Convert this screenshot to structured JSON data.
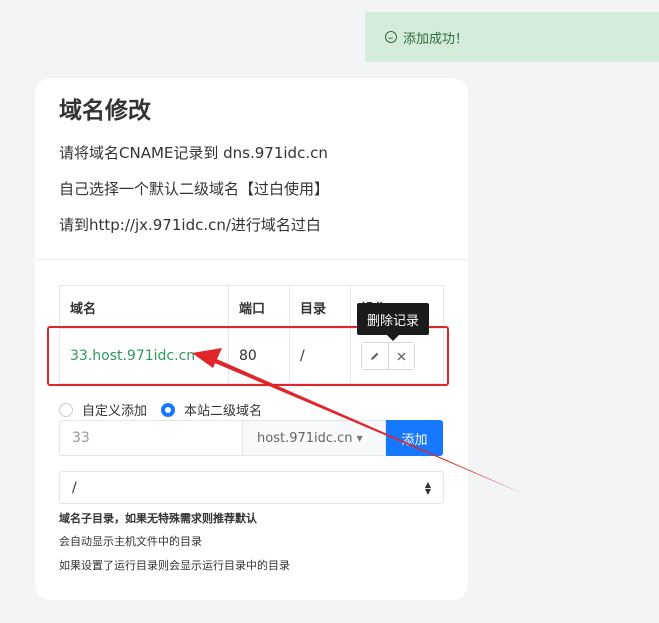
{
  "toast": {
    "icon": "smile-icon",
    "text": "添加成功！"
  },
  "card": {
    "title": "域名修改",
    "info_lines": [
      "请将域名CNAME记录到 dns.971idc.cn",
      "自己选择一个默认二级域名【过白使用】",
      "请到http://jx.971idc.cn/进行域名过白"
    ]
  },
  "table": {
    "headers": [
      "域名",
      "端口",
      "目录",
      "操作"
    ],
    "rows": [
      {
        "domain": "33.host.971idc.cn",
        "port": "80",
        "dir": "/"
      }
    ],
    "tooltip": "删除记录"
  },
  "form": {
    "radio_options": [
      "自定义添加",
      "本站二级域名"
    ],
    "radio_selected": "本站二级域名",
    "prefix_value": "33",
    "suffix_value": "host.971idc.cn",
    "add_label": "添加",
    "dir_value": "/",
    "help_strong": "域名子目录，如果无特殊需求则推荐默认",
    "help_lines": [
      "会自动显示主机文件中的目录",
      "如果设置了运行目录则会显示运行目录中的目录"
    ]
  },
  "colors": {
    "primary": "#1677ff",
    "success_text": "#2d9a57",
    "toast_bg": "#d5ecdb",
    "annotation": "#e0262b"
  }
}
